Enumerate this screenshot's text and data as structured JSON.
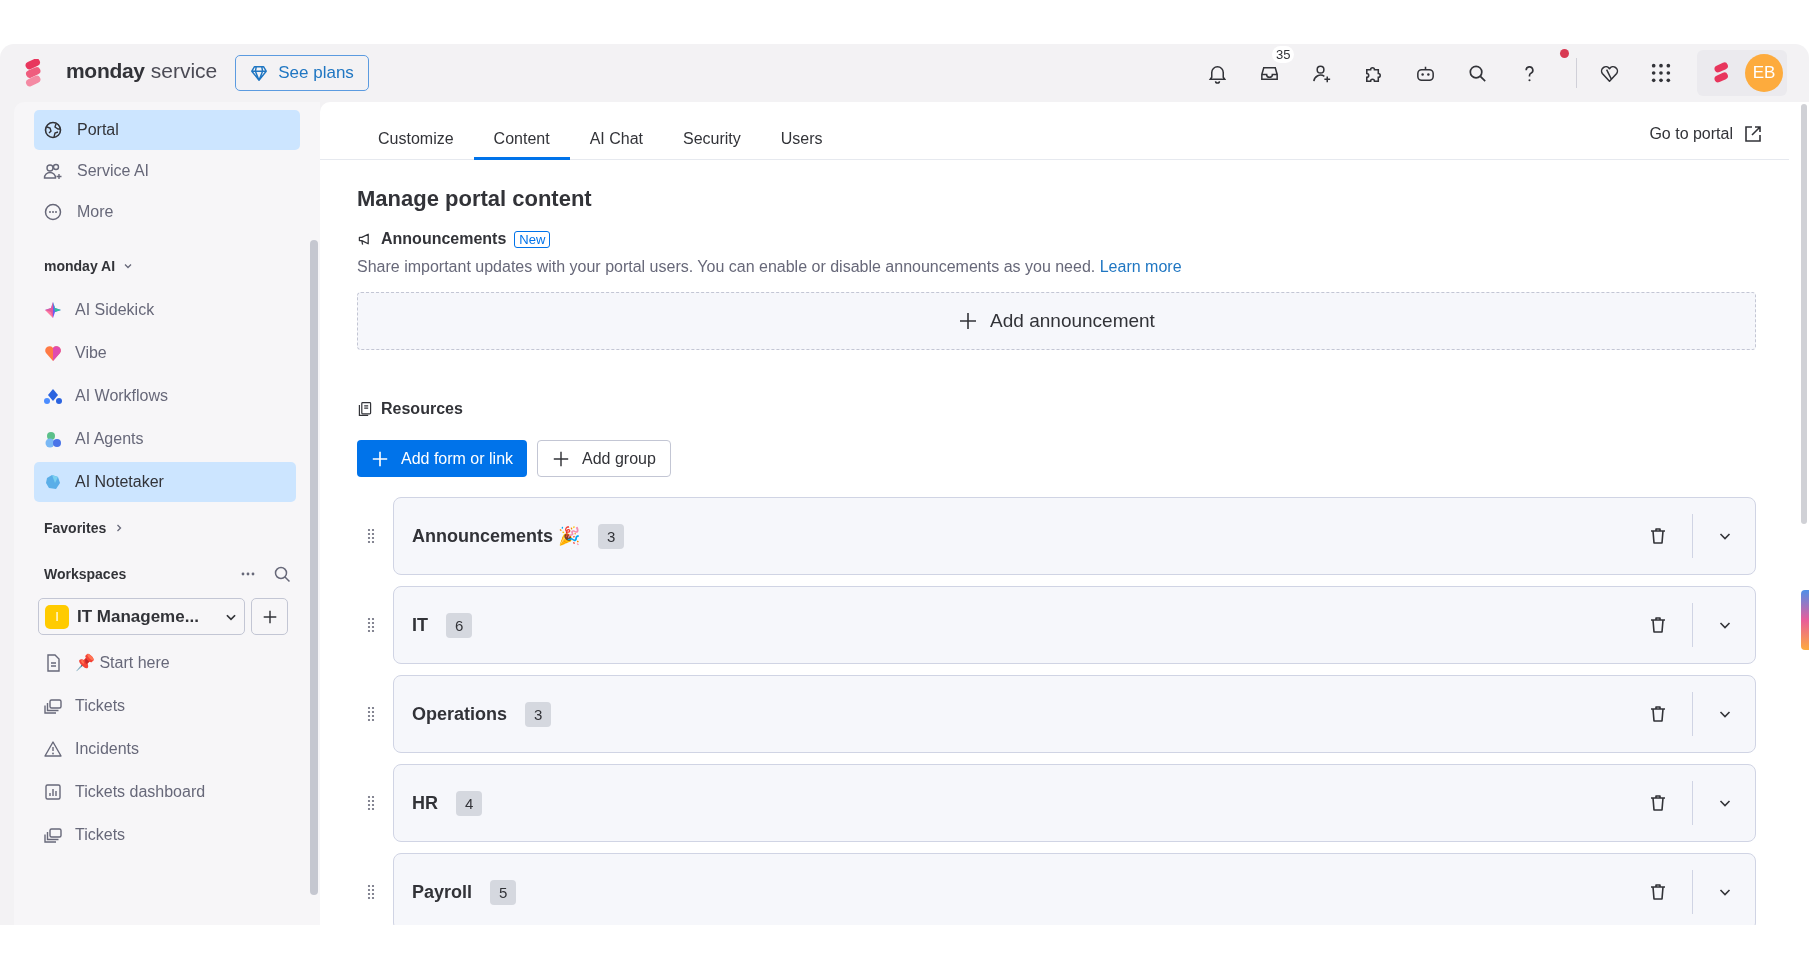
{
  "header": {
    "brand": "monday",
    "product": "service",
    "plans_button": "See plans",
    "inbox_count": "35",
    "help_notification": true,
    "avatar": "EB"
  },
  "sidebar": {
    "nav": [
      {
        "label": "Portal",
        "kind": "globe",
        "selected": true
      },
      {
        "label": "Service AI",
        "kind": "people",
        "selected": false
      },
      {
        "label": "More",
        "kind": "dots",
        "selected": false
      }
    ],
    "ai_section": {
      "title": "monday AI",
      "expanded": true,
      "items": [
        {
          "label": "AI Sidekick",
          "kind": "sparkle",
          "selected": false
        },
        {
          "label": "Vibe",
          "kind": "heart",
          "selected": false
        },
        {
          "label": "AI Workflows",
          "kind": "flow",
          "selected": false
        },
        {
          "label": "AI Agents",
          "kind": "agents",
          "selected": false
        },
        {
          "label": "AI Notetaker",
          "kind": "notetaker",
          "selected": true
        }
      ]
    },
    "favorites": "Favorites",
    "workspaces": {
      "title": "Workspaces",
      "workspace": {
        "initial": "I",
        "name": "IT Manageme..."
      },
      "items": [
        {
          "label": "📌 Start here",
          "kind": "doc"
        },
        {
          "label": "Tickets",
          "kind": "board"
        },
        {
          "label": "Incidents",
          "kind": "warning"
        },
        {
          "label": "Tickets dashboard",
          "kind": "dashboard"
        },
        {
          "label": "Tickets",
          "kind": "board"
        }
      ]
    }
  },
  "main": {
    "tabs": [
      {
        "label": "Customize",
        "selected": false
      },
      {
        "label": "Content",
        "selected": true
      },
      {
        "label": "AI Chat",
        "selected": false
      },
      {
        "label": "Security",
        "selected": false
      },
      {
        "label": "Users",
        "selected": false
      }
    ],
    "go_to_portal": "Go to portal",
    "heading": "Manage portal content",
    "announcements": {
      "title": "Announcements",
      "badge": "New",
      "description": "Share important updates with your portal users. You can enable or disable announcements as you need.",
      "link": "Learn more",
      "add_button": "Add announcement"
    },
    "resources": {
      "title": "Resources",
      "primary_button": "Add form or link",
      "secondary_button": "Add group",
      "groups": [
        {
          "name": "Announcements 🎉",
          "count": "3"
        },
        {
          "name": "IT",
          "count": "6"
        },
        {
          "name": "Operations",
          "count": "3"
        },
        {
          "name": "HR",
          "count": "4"
        },
        {
          "name": "Payroll",
          "count": "5"
        }
      ]
    }
  }
}
